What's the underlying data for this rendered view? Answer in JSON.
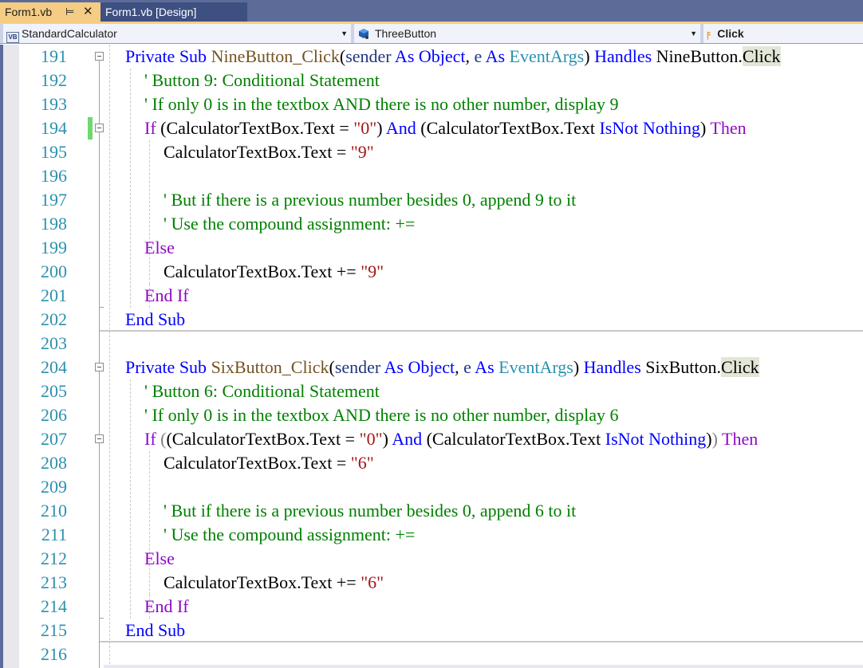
{
  "tabs": [
    {
      "label": "Form1.vb",
      "active": true,
      "pin_icon": "pin-icon",
      "close_icon": "close-icon"
    },
    {
      "label": "Form1.vb [Design]",
      "active": false
    }
  ],
  "navbar": {
    "class_dropdown": {
      "icon": "vb-class-icon",
      "icon_text": "VB",
      "value": "StandardCalculator"
    },
    "member_dropdown": {
      "icon": "object-cube-icon",
      "value": "ThreeButton"
    },
    "event_dropdown": {
      "icon": "lightning-bolt-icon",
      "value": "Click"
    }
  },
  "colors": {
    "tab_active": "#f5cc84",
    "frame": "#5d6b99",
    "keyword": "#0000ff",
    "control_keyword": "#8f08c4",
    "comment": "#008000",
    "string": "#a31515",
    "type": "#2b91af",
    "method": "#74531f",
    "line_number": "#2b91af",
    "change_marker": "#6ed96e"
  },
  "editor": {
    "lines": [
      {
        "n": "191",
        "parts": {
          "p1": "Private Sub ",
          "p2": "NineButton_Click",
          "p3": "(",
          "p4": "sender",
          "p5": " As Object",
          "p6": ", ",
          "p7": "e",
          "p8": " As ",
          "p9": "EventArgs",
          "p10": ") ",
          "p11": "Handles",
          "p12": " NineButton.",
          "p13": "Click"
        }
      },
      {
        "n": "192",
        "text": "' Button 9: Conditional Statement"
      },
      {
        "n": "193",
        "text": "' If only 0 is in the textbox AND there is no other number, display 9"
      },
      {
        "n": "194",
        "parts": {
          "p1": "If",
          "p2": " (CalculatorTextBox.Text = ",
          "p3": "\"0\"",
          "p4": ") ",
          "p5": "And",
          "p6": " (CalculatorTextBox.Text ",
          "p7": "IsNot Nothing",
          "p8": ") ",
          "p9": "Then"
        }
      },
      {
        "n": "195",
        "parts": {
          "p1": "CalculatorTextBox.Text = ",
          "p2": "\"9\""
        }
      },
      {
        "n": "196",
        "text": ""
      },
      {
        "n": "197",
        "text": "' But if there is a previous number besides 0, append 9 to it"
      },
      {
        "n": "198",
        "text": "' Use the compound assignment: +="
      },
      {
        "n": "199",
        "text": "Else"
      },
      {
        "n": "200",
        "parts": {
          "p1": "CalculatorTextBox.Text += ",
          "p2": "\"9\""
        }
      },
      {
        "n": "201",
        "text": "End If"
      },
      {
        "n": "202",
        "text": "End Sub"
      },
      {
        "n": "203",
        "text": ""
      },
      {
        "n": "204",
        "parts": {
          "p1": "Private Sub ",
          "p2": "SixButton_Click",
          "p3": "(",
          "p4": "sender",
          "p5": " As Object",
          "p6": ", ",
          "p7": "e",
          "p8": " As ",
          "p9": "EventArgs",
          "p10": ") ",
          "p11": "Handles",
          "p12": " SixButton.",
          "p13": "Click"
        }
      },
      {
        "n": "205",
        "text": "' Button 6: Conditional Statement"
      },
      {
        "n": "206",
        "text": "' If only 0 is in the textbox AND there is no other number, display 6"
      },
      {
        "n": "207",
        "parts": {
          "p1": "If",
          "p2": " ",
          "p3": "(",
          "p4": "(CalculatorTextBox.Text = ",
          "p5": "\"0\"",
          "p6": ") ",
          "p7": "And",
          "p8": " (CalculatorTextBox.Text ",
          "p9": "IsNot Nothing",
          "p10": ")",
          "p11": ")",
          "p12": " ",
          "p13": "Then"
        }
      },
      {
        "n": "208",
        "parts": {
          "p1": "CalculatorTextBox.Text = ",
          "p2": "\"6\""
        }
      },
      {
        "n": "209",
        "text": ""
      },
      {
        "n": "210",
        "text": "' But if there is a previous number besides 0, append 6 to it"
      },
      {
        "n": "211",
        "text": "' Use the compound assignment: +="
      },
      {
        "n": "212",
        "text": "Else"
      },
      {
        "n": "213",
        "parts": {
          "p1": "CalculatorTextBox.Text += ",
          "p2": "\"6\""
        }
      },
      {
        "n": "214",
        "text": "End If"
      },
      {
        "n": "215",
        "text": "End Sub"
      },
      {
        "n": "216",
        "text": ""
      }
    ]
  }
}
